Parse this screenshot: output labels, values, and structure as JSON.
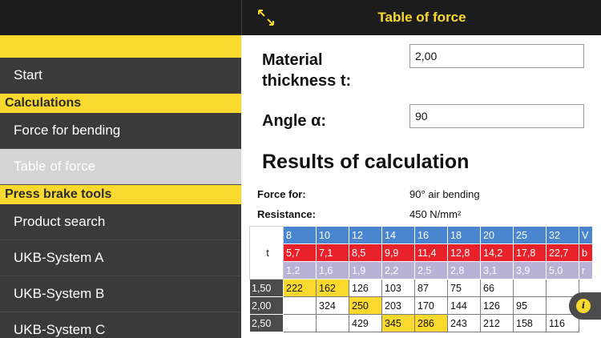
{
  "header": {
    "title": "Table of force"
  },
  "sidebar": {
    "items_top": [
      {
        "label": "Start"
      }
    ],
    "section_calculations": "Calculations",
    "calc_items": [
      {
        "label": "Force for bending"
      },
      {
        "label": "Table of force"
      }
    ],
    "section_tools": "Press brake tools",
    "tool_items": [
      {
        "label": "Product search"
      },
      {
        "label": "UKB-System A"
      },
      {
        "label": "UKB-System B"
      },
      {
        "label": "UKB-System C"
      }
    ]
  },
  "form": {
    "thickness_label_line1": "Material",
    "thickness_label_line2": "thickness t:",
    "thickness_value": "2,00",
    "angle_label": "Angle α:",
    "angle_value": "90"
  },
  "results": {
    "title": "Results of calculation",
    "force_for_label": "Force for:",
    "force_for_value": "90° air bending",
    "resistance_label": "Resistance:",
    "resistance_value": "450 N/mm²"
  },
  "table": {
    "t_label": "t",
    "v_row": [
      "8",
      "10",
      "12",
      "14",
      "16",
      "18",
      "20",
      "25",
      "32"
    ],
    "v_end": "V",
    "b_row": [
      "5,7",
      "7,1",
      "8,5",
      "9,9",
      "11,4",
      "12,8",
      "14,2",
      "17,8",
      "22,7"
    ],
    "b_end": "b",
    "r_row": [
      "1,2",
      "1,6",
      "1,9",
      "2,2",
      "2,5",
      "2,8",
      "3,1",
      "3,9",
      "5,0"
    ],
    "r_end": "r",
    "rows": [
      {
        "t": "1,50",
        "values": [
          "222",
          "162",
          "126",
          "103",
          "87",
          "75",
          "66",
          "",
          ""
        ],
        "highlight": [
          0,
          1
        ]
      },
      {
        "t": "2,00",
        "values": [
          "",
          "324",
          "250",
          "203",
          "170",
          "144",
          "126",
          "95",
          ""
        ],
        "highlight": [
          2
        ]
      },
      {
        "t": "2,50",
        "values": [
          "",
          "",
          "429",
          "345",
          "286",
          "243",
          "212",
          "158",
          "116"
        ],
        "highlight": [
          3,
          4
        ]
      }
    ]
  },
  "info_button": {
    "glyph": "i"
  },
  "colors": {
    "accent_yellow": "#f9d92e",
    "sidebar_bg": "#3a3a3a",
    "header_bg": "#1c1c1c",
    "row_blue": "#4a86d0",
    "row_red": "#e8212b",
    "row_lavender": "#b7b2d6"
  }
}
